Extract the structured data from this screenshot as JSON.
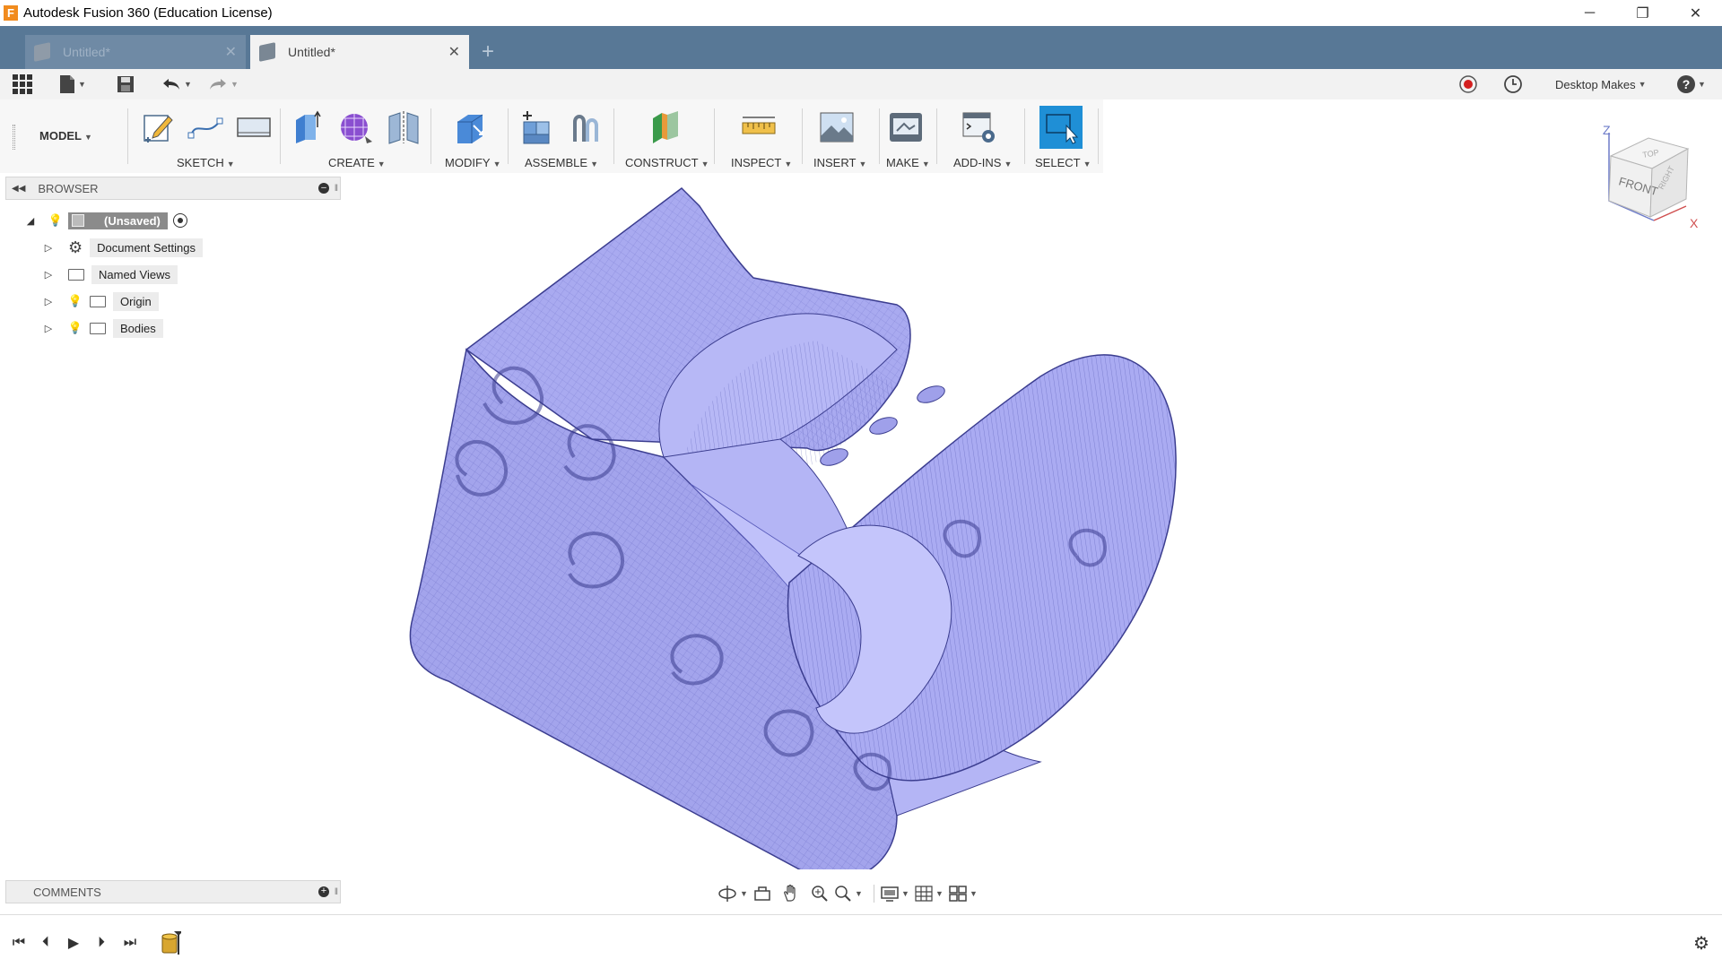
{
  "window": {
    "title": "Autodesk Fusion 360 (Education License)",
    "logo_letter": "F",
    "minimize": "─",
    "restore": "❐",
    "close": "✕"
  },
  "tabs": [
    {
      "label": "Untitled*",
      "active": false
    },
    {
      "label": "Untitled*",
      "active": true
    }
  ],
  "new_tab_label": "+",
  "quick_access": {
    "workspace_label": "Desktop Makes",
    "help_label": "?"
  },
  "ribbon": {
    "workspace": "MODEL",
    "groups": [
      {
        "label": "SKETCH"
      },
      {
        "label": "CREATE"
      },
      {
        "label": "MODIFY"
      },
      {
        "label": "ASSEMBLE"
      },
      {
        "label": "CONSTRUCT"
      },
      {
        "label": "INSPECT"
      },
      {
        "label": "INSERT"
      },
      {
        "label": "MAKE"
      },
      {
        "label": "ADD-INS"
      },
      {
        "label": "SELECT"
      }
    ]
  },
  "browser": {
    "title": "BROWSER",
    "root": "(Unsaved)",
    "items": [
      {
        "label": "Document Settings"
      },
      {
        "label": "Named Views"
      },
      {
        "label": "Origin"
      },
      {
        "label": "Bodies"
      }
    ]
  },
  "comments": {
    "title": "COMMENTS"
  },
  "viewcube": {
    "front": "FRONT",
    "top": "TOP",
    "right": "RIGHT",
    "axis_z": "Z",
    "axis_x": "X"
  },
  "colors": {
    "model_fill": "#a9aaf0",
    "model_edge": "#3b3d8f",
    "tabstrip": "#587896",
    "select_accent": "#1f8fd6"
  }
}
